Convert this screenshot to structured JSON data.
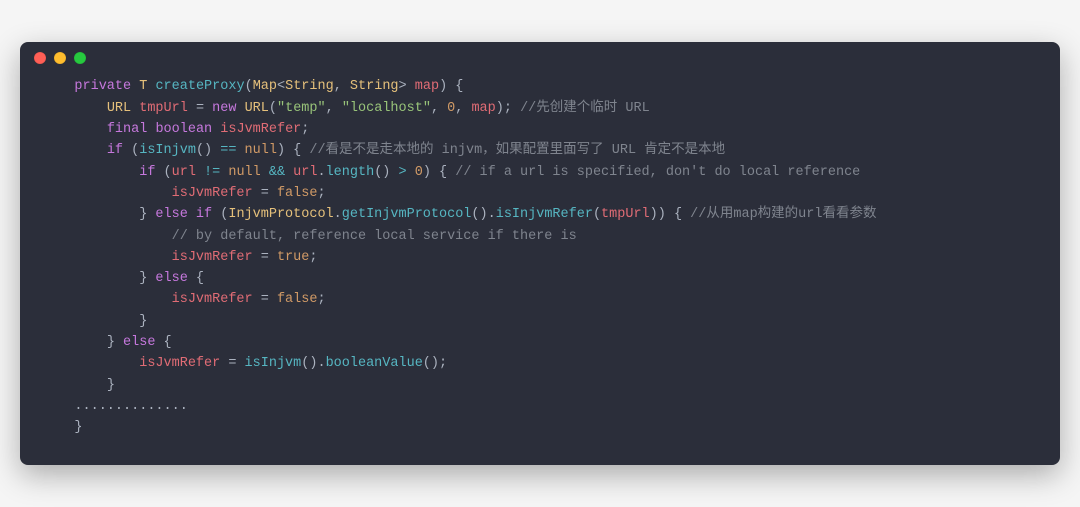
{
  "code": {
    "lines": [
      {
        "indent": 1,
        "tokens": [
          {
            "t": "private",
            "c": "kw"
          },
          {
            "t": " "
          },
          {
            "t": "T",
            "c": "type"
          },
          {
            "t": " "
          },
          {
            "t": "createProxy",
            "c": "fn"
          },
          {
            "t": "(",
            "c": "punct"
          },
          {
            "t": "Map",
            "c": "type"
          },
          {
            "t": "<",
            "c": "punct"
          },
          {
            "t": "String",
            "c": "type"
          },
          {
            "t": ", ",
            "c": "punct"
          },
          {
            "t": "String",
            "c": "type"
          },
          {
            "t": ">",
            "c": "punct"
          },
          {
            "t": " "
          },
          {
            "t": "map",
            "c": "ident"
          },
          {
            "t": ")",
            "c": "punct"
          },
          {
            "t": " {",
            "c": "punct"
          }
        ]
      },
      {
        "indent": 2,
        "tokens": [
          {
            "t": "URL",
            "c": "type"
          },
          {
            "t": " "
          },
          {
            "t": "tmpUrl",
            "c": "ident"
          },
          {
            "t": " = ",
            "c": "punct"
          },
          {
            "t": "new",
            "c": "kw"
          },
          {
            "t": " "
          },
          {
            "t": "URL",
            "c": "type"
          },
          {
            "t": "(",
            "c": "punct"
          },
          {
            "t": "\"temp\"",
            "c": "str"
          },
          {
            "t": ", ",
            "c": "punct"
          },
          {
            "t": "\"localhost\"",
            "c": "str"
          },
          {
            "t": ", ",
            "c": "punct"
          },
          {
            "t": "0",
            "c": "num"
          },
          {
            "t": ", ",
            "c": "punct"
          },
          {
            "t": "map",
            "c": "ident"
          },
          {
            "t": "); ",
            "c": "punct"
          },
          {
            "t": "//先创建个临时 URL",
            "c": "comment"
          }
        ]
      },
      {
        "indent": 2,
        "tokens": [
          {
            "t": "final",
            "c": "kw"
          },
          {
            "t": " "
          },
          {
            "t": "boolean",
            "c": "kw"
          },
          {
            "t": " "
          },
          {
            "t": "isJvmRefer",
            "c": "ident"
          },
          {
            "t": ";",
            "c": "punct"
          }
        ]
      },
      {
        "indent": 2,
        "tokens": [
          {
            "t": "if",
            "c": "kw"
          },
          {
            "t": " (",
            "c": "punct"
          },
          {
            "t": "isInjvm",
            "c": "fn"
          },
          {
            "t": "()",
            "c": "punct"
          },
          {
            "t": " == ",
            "c": "op"
          },
          {
            "t": "null",
            "c": "bool"
          },
          {
            "t": ") { ",
            "c": "punct"
          },
          {
            "t": "//看是不是走本地的 injvm，如果配置里面写了 URL 肯定不是本地",
            "c": "comment"
          }
        ]
      },
      {
        "indent": 3,
        "tokens": [
          {
            "t": "if",
            "c": "kw"
          },
          {
            "t": " (",
            "c": "punct"
          },
          {
            "t": "url",
            "c": "ident"
          },
          {
            "t": " != ",
            "c": "op"
          },
          {
            "t": "null",
            "c": "bool"
          },
          {
            "t": " && ",
            "c": "op"
          },
          {
            "t": "url",
            "c": "ident"
          },
          {
            "t": ".",
            "c": "punct"
          },
          {
            "t": "length",
            "c": "fn"
          },
          {
            "t": "()",
            "c": "punct"
          },
          {
            "t": " > ",
            "c": "op"
          },
          {
            "t": "0",
            "c": "num"
          },
          {
            "t": ") { ",
            "c": "punct"
          },
          {
            "t": "// if a url is specified, don't do local reference",
            "c": "comment"
          }
        ]
      },
      {
        "indent": 4,
        "tokens": [
          {
            "t": "isJvmRefer",
            "c": "ident"
          },
          {
            "t": " = ",
            "c": "punct"
          },
          {
            "t": "false",
            "c": "bool"
          },
          {
            "t": ";",
            "c": "punct"
          }
        ]
      },
      {
        "indent": 3,
        "tokens": [
          {
            "t": "} ",
            "c": "punct"
          },
          {
            "t": "else if",
            "c": "kw"
          },
          {
            "t": " (",
            "c": "punct"
          },
          {
            "t": "InjvmProtocol",
            "c": "type"
          },
          {
            "t": ".",
            "c": "punct"
          },
          {
            "t": "getInjvmProtocol",
            "c": "fn"
          },
          {
            "t": "().",
            "c": "punct"
          },
          {
            "t": "isInjvmRefer",
            "c": "fn"
          },
          {
            "t": "(",
            "c": "punct"
          },
          {
            "t": "tmpUrl",
            "c": "ident"
          },
          {
            "t": ")) { ",
            "c": "punct"
          },
          {
            "t": "//从用map构建的url看看参数",
            "c": "comment"
          }
        ]
      },
      {
        "indent": 4,
        "tokens": [
          {
            "t": "// by default, reference local service if there is",
            "c": "comment"
          }
        ]
      },
      {
        "indent": 4,
        "tokens": [
          {
            "t": "isJvmRefer",
            "c": "ident"
          },
          {
            "t": " = ",
            "c": "punct"
          },
          {
            "t": "true",
            "c": "bool"
          },
          {
            "t": ";",
            "c": "punct"
          }
        ]
      },
      {
        "indent": 3,
        "tokens": [
          {
            "t": "} ",
            "c": "punct"
          },
          {
            "t": "else",
            "c": "kw"
          },
          {
            "t": " {",
            "c": "punct"
          }
        ]
      },
      {
        "indent": 4,
        "tokens": [
          {
            "t": "isJvmRefer",
            "c": "ident"
          },
          {
            "t": " = ",
            "c": "punct"
          },
          {
            "t": "false",
            "c": "bool"
          },
          {
            "t": ";",
            "c": "punct"
          }
        ]
      },
      {
        "indent": 3,
        "tokens": [
          {
            "t": "}",
            "c": "punct"
          }
        ]
      },
      {
        "indent": 2,
        "tokens": [
          {
            "t": "} ",
            "c": "punct"
          },
          {
            "t": "else",
            "c": "kw"
          },
          {
            "t": " {",
            "c": "punct"
          }
        ]
      },
      {
        "indent": 3,
        "tokens": [
          {
            "t": "isJvmRefer",
            "c": "ident"
          },
          {
            "t": " = ",
            "c": "punct"
          },
          {
            "t": "isInjvm",
            "c": "fn"
          },
          {
            "t": "().",
            "c": "punct"
          },
          {
            "t": "booleanValue",
            "c": "fn"
          },
          {
            "t": "();",
            "c": "punct"
          }
        ]
      },
      {
        "indent": 2,
        "tokens": [
          {
            "t": "}",
            "c": "punct"
          }
        ]
      },
      {
        "indent": 1,
        "tokens": [
          {
            "t": "..............",
            "c": "punct"
          }
        ]
      },
      {
        "indent": 1,
        "tokens": [
          {
            "t": "}",
            "c": "punct"
          }
        ]
      }
    ]
  }
}
